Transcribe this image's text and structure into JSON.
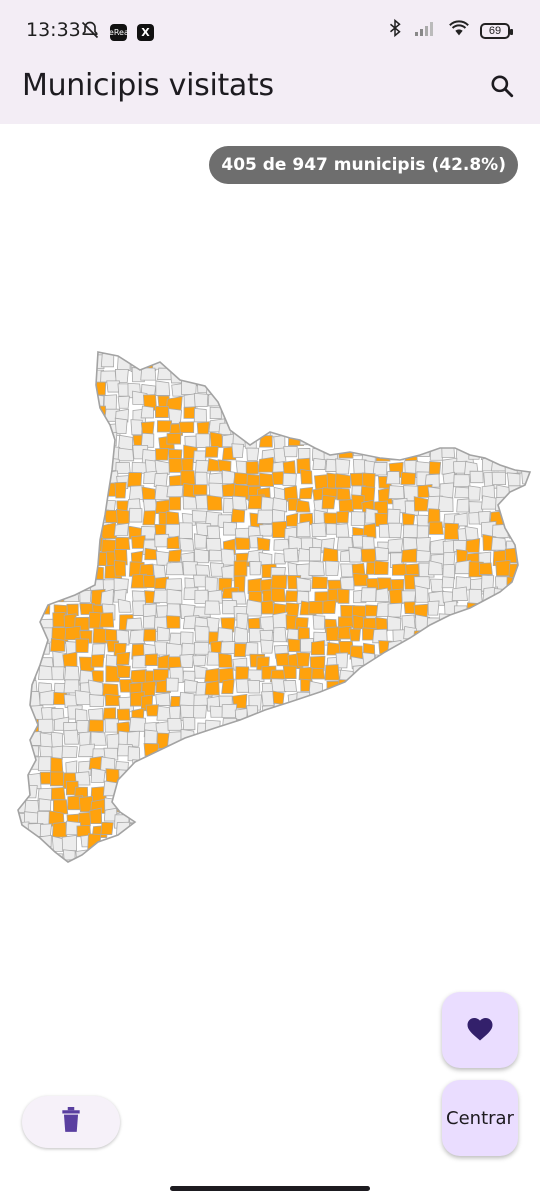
{
  "status_bar": {
    "time": "13:33",
    "apps": [
      "BeReal.",
      "X"
    ],
    "battery": "69",
    "icons": [
      "silent-icon",
      "bluetooth-icon",
      "signal-icon",
      "wifi-icon",
      "battery-icon"
    ]
  },
  "app_bar": {
    "title": "Municipis visitats",
    "search_icon": "search-icon"
  },
  "map": {
    "counter_text": "405 de 947 municipis (42.8%)",
    "visited": 405,
    "total": 947,
    "colors": {
      "visited": "#ffa20d",
      "unvisited": "#ececec",
      "border": "#a9a9a9"
    }
  },
  "actions": {
    "favorite_icon": "heart-icon",
    "center_label": "Centrar",
    "delete_icon": "trash-icon"
  },
  "theme": {
    "bar_bg": "#f3edf5",
    "fab_bg": "#eaddff",
    "icon_purple": "#33206b"
  }
}
